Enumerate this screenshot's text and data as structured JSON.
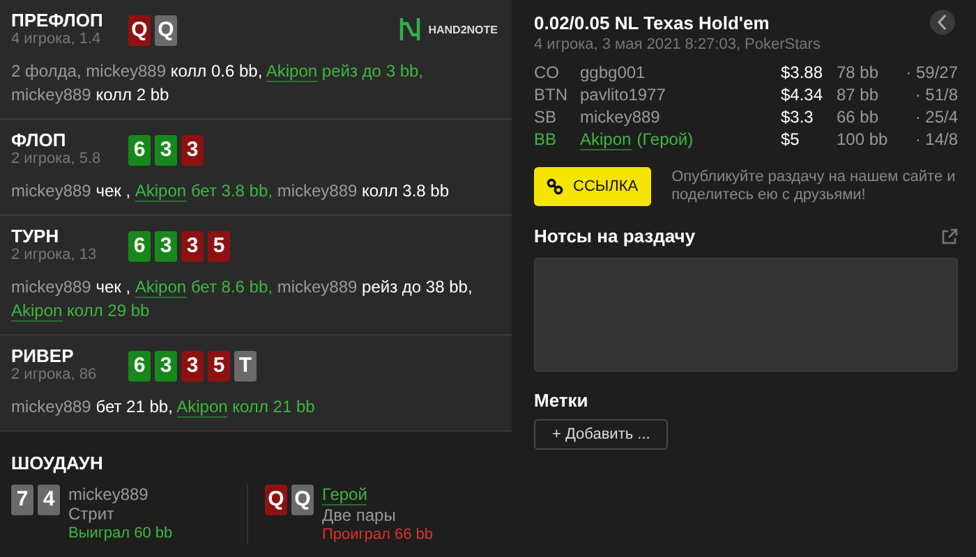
{
  "streets": [
    {
      "name": "ПРЕФЛОП",
      "info": "4 игрока, 1.4",
      "cards": [
        {
          "rank": "Q",
          "color": "#8e1111"
        },
        {
          "rank": "Q",
          "color": "#6a6a6a"
        }
      ],
      "logo": "HAND2NOTE",
      "actions": [
        {
          "player": "2 фолда,",
          "hero": false
        },
        {
          "player": "mickey889",
          "text": "колл 0.6 bb,",
          "hero": false
        },
        {
          "player": "Akipon",
          "text": "рейз до 3 bb,",
          "hero": true
        },
        {
          "player": "mickey889",
          "text": "колл 2 bb",
          "hero": false
        }
      ]
    },
    {
      "name": "ФЛОП",
      "info": "2 игрока, 5.8",
      "cards": [
        {
          "rank": "6",
          "color": "#17881c"
        },
        {
          "rank": "3",
          "color": "#17881c"
        },
        {
          "rank": "3",
          "color": "#8e1111"
        }
      ],
      "actions": [
        {
          "player": "mickey889",
          "text": "чек ,",
          "hero": false
        },
        {
          "player": "Akipon",
          "text": "бет 3.8 bb,",
          "hero": true
        },
        {
          "player": "mickey889",
          "text": "колл 3.8 bb",
          "hero": false
        }
      ]
    },
    {
      "name": "ТУРН",
      "info": "2 игрока, 13",
      "cards": [
        {
          "rank": "6",
          "color": "#17881c"
        },
        {
          "rank": "3",
          "color": "#17881c"
        },
        {
          "rank": "3",
          "color": "#8e1111"
        },
        {
          "rank": "5",
          "color": "#8e1111"
        }
      ],
      "actions": [
        {
          "player": "mickey889",
          "text": "чек ,",
          "hero": false
        },
        {
          "player": "Akipon",
          "text": "бет 8.6 bb,",
          "hero": true
        },
        {
          "player": "mickey889",
          "text": "рейз до 38 bb,",
          "hero": false
        },
        {
          "player": "Akipon",
          "text": "колл 29 bb",
          "hero": true
        }
      ]
    },
    {
      "name": "РИВЕР",
      "info": "2 игрока, 86",
      "cards": [
        {
          "rank": "6",
          "color": "#17881c"
        },
        {
          "rank": "3",
          "color": "#17881c"
        },
        {
          "rank": "3",
          "color": "#8e1111"
        },
        {
          "rank": "5",
          "color": "#8e1111"
        },
        {
          "rank": "T",
          "color": "#6a6a6a"
        }
      ],
      "actions": [
        {
          "player": "mickey889",
          "text": "бет 21 bb,",
          "hero": false
        },
        {
          "player": "Akipon",
          "text": "колл 21 bb",
          "hero": true
        }
      ]
    }
  ],
  "showdown": {
    "title": "ШОУДАУН",
    "players": [
      {
        "name": "mickey889",
        "hand": "Стрит",
        "result": "Выиграл 60 bb",
        "hero": false,
        "won": true,
        "cards": [
          {
            "rank": "7",
            "color": "#6a6a6a"
          },
          {
            "rank": "4",
            "color": "#6a6a6a"
          }
        ]
      },
      {
        "name": "Герой",
        "hand": "Две пары",
        "result": "Проиграл 66 bb",
        "hero": true,
        "won": false,
        "cards": [
          {
            "rank": "Q",
            "color": "#8e1111"
          },
          {
            "rank": "Q",
            "color": "#6a6a6a"
          }
        ]
      }
    ]
  },
  "hand": {
    "title": "0.02/0.05 NL Texas Hold'em",
    "subtitle": "4 игрока, 3 мая 2021 8:27:03, PokerStars",
    "players": [
      {
        "position": "CO",
        "name": "ggbg001",
        "stack": "$3.88",
        "bb": "78 bb",
        "stats": "· 59/27",
        "hero": false
      },
      {
        "position": "BTN",
        "name": "pavlito1977",
        "stack": "$4.34",
        "bb": "87 bb",
        "stats": "· 51/8",
        "hero": false
      },
      {
        "position": "SB",
        "name": "mickey889",
        "stack": "$3.3",
        "bb": "66 bb",
        "stats": "· 25/4",
        "hero": false
      },
      {
        "position": "BB",
        "name": "Akipon",
        "tag": "(Герой)",
        "stack": "$5",
        "bb": "100 bb",
        "stats": "· 14/8",
        "hero": true
      }
    ]
  },
  "share": {
    "button": "ССЫЛКА",
    "text": "Опубликуйте раздачу на нашем сайте и поделитесь ею с друзьями!"
  },
  "notes": {
    "title": "Нотсы на раздачу"
  },
  "tags": {
    "title": "Метки",
    "button": "+ Добавить ..."
  }
}
